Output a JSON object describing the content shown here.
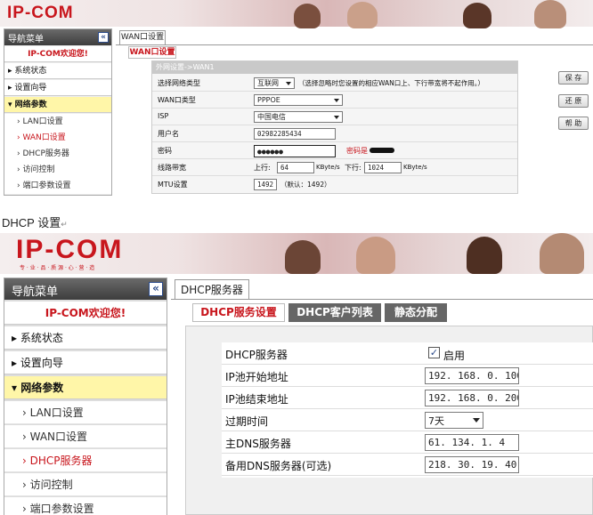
{
  "top": {
    "brand": "IP-COM",
    "nav_title": "导航菜单",
    "collapse_glyph": "«",
    "welcome": "IP-COM欢迎您!",
    "menu": [
      {
        "label": "系统状态",
        "arrow": "▸"
      },
      {
        "label": "设置向导",
        "arrow": "▸"
      },
      {
        "label": "网络参数",
        "arrow": "▾"
      }
    ],
    "submenu": [
      "LAN口设置",
      "WAN口设置",
      "DHCP服务器",
      "访问控制",
      "端口参数设置"
    ],
    "tab": "WAN口设置",
    "subtab": "WAN口设置",
    "section": "外网设置->WAN1",
    "rows": {
      "net_type_label": "选择网络类型",
      "net_type_value": "互联网",
      "net_type_hint": "（选择忽略时您设置的相应WAN口上、下行带宽将不起作用。）",
      "wan_type_label": "WAN口类型",
      "wan_type_value": "PPPOE",
      "isp_label": "ISP",
      "isp_value": "中国电信",
      "user_label": "用户名",
      "user_value": "02982285434",
      "pwd_label": "密码",
      "pwd_value": "●●●●●●",
      "pwd_hint": "密码是",
      "bw_label": "线路带宽",
      "up_label": "上行:",
      "up_value": "64",
      "up_unit": "KByte/s",
      "down_label": "下行:",
      "down_value": "1024",
      "down_unit": "KByte/s",
      "mtu_label": "MTU设置",
      "mtu_value": "1492",
      "mtu_hint": "（默认：1492）"
    },
    "buttons": [
      "保 存",
      "还 原",
      "帮 助"
    ]
  },
  "caption": "DHCP 设置",
  "caption_mark": "↵",
  "bottom": {
    "brand": "IP-COM",
    "brand_sub": "专 · 业 · 品 · 质   源 · 心 · 营 · 造",
    "nav_title": "导航菜单",
    "collapse_glyph": "«",
    "welcome": "IP-COM欢迎您!",
    "menu": [
      {
        "label": "系统状态",
        "arrow": "▸"
      },
      {
        "label": "设置向导",
        "arrow": "▸"
      },
      {
        "label": "网络参数",
        "arrow": "▾"
      }
    ],
    "submenu": [
      "LAN口设置",
      "WAN口设置",
      "DHCP服务器",
      "访问控制",
      "端口参数设置"
    ],
    "tab": "DHCP服务器",
    "subtabs": [
      "DHCP服务设置",
      "DHCP客户列表",
      "静态分配"
    ],
    "rows": {
      "server_label": "DHCP服务器",
      "server_check": "✓",
      "server_value": "启用",
      "start_label": "IP池开始地址",
      "start_value": "192. 168. 0. 100",
      "end_label": "IP池结束地址",
      "end_value": "192. 168. 0. 200",
      "expire_label": "过期时间",
      "expire_value": "7天",
      "dns1_label": "主DNS服务器",
      "dns1_value": "61. 134. 1. 4",
      "dns2_label": "备用DNS服务器(可选)",
      "dns2_value": "218. 30. 19. 40"
    }
  }
}
